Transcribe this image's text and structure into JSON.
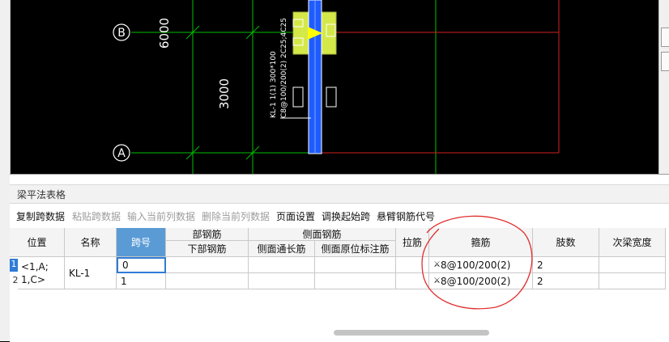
{
  "drawing": {
    "axis_b_label": "B",
    "axis_a_label": "A",
    "dim_upper": "6000",
    "dim_lower": "3000",
    "beam_annotation_line1": "KL-1 1(1) 300*100",
    "beam_annotation_line2": "C8@100/200(2) 2C25;4C25",
    "colors": {
      "grid_green": "#00c000",
      "beam_blue": "#1f5cff",
      "column_red": "#d42020",
      "column_fill": "#d4e84a",
      "marker_yellow": "#ffff00"
    }
  },
  "panel": {
    "title": "梁平法表格",
    "toolbar": [
      {
        "label": "复制跨数据",
        "enabled": true
      },
      {
        "label": "粘贴跨数据",
        "enabled": false
      },
      {
        "label": "输入当前列数据",
        "enabled": false
      },
      {
        "label": "删除当前列数据",
        "enabled": false
      },
      {
        "label": "页面设置",
        "enabled": true
      },
      {
        "label": "调换起始跨",
        "enabled": true
      },
      {
        "label": "悬臂钢筋代号",
        "enabled": true
      }
    ]
  },
  "table": {
    "headers": {
      "position": "位置",
      "name": "名称",
      "span_no": "跨号",
      "bottom_group": "部钢筋",
      "bottom_rebar": "下部钢筋",
      "side_group": "侧面钢筋",
      "side_through": "侧面通长筋",
      "side_original": "侧面原位标注筋",
      "tie": "拉筋",
      "stirrup": "箍筋",
      "legs": "肢数",
      "secondary_width": "次梁宽度"
    },
    "row_numbers": [
      "1",
      "2"
    ],
    "position_value": "<1,A;\n1,C>",
    "name_value": "KL-1",
    "rows": [
      {
        "span": "0",
        "bottom": "",
        "side_through": "",
        "side_original": "",
        "tie": "",
        "stirrup": "8@100/200(2)",
        "legs": "2",
        "secondary_width": ""
      },
      {
        "span": "1",
        "bottom": "",
        "side_through": "",
        "side_original": "",
        "tie": "",
        "stirrup": "8@100/200(2)",
        "legs": "2",
        "secondary_width": ""
      }
    ],
    "stirrup_symbol": "rebar-grade-iii-symbol"
  }
}
